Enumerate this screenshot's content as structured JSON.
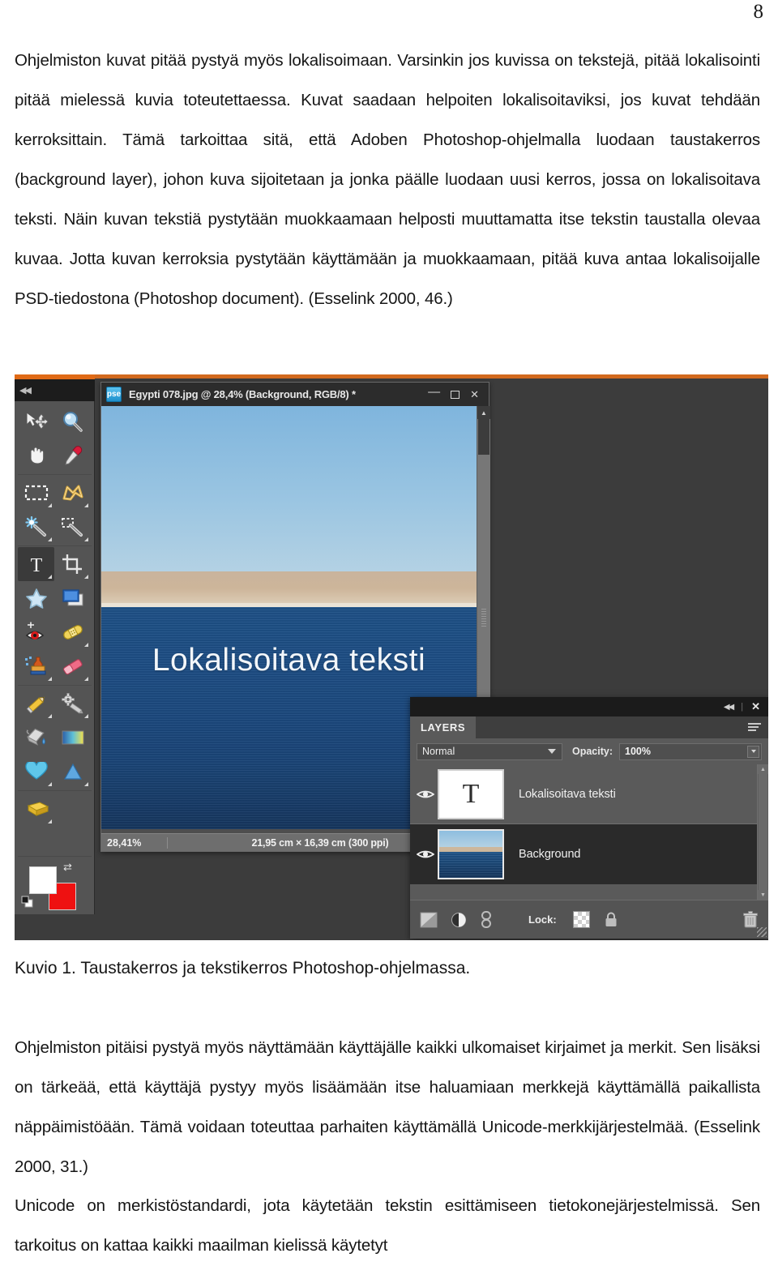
{
  "document": {
    "page_number": "8",
    "paragraphs": {
      "intro": "Ohjelmiston kuvat pitää pystyä myös lokalisoimaan. Varsinkin jos kuvissa on tekstejä, pitää lokalisointi pitää mielessä kuvia toteutettaessa. Kuvat saadaan helpoiten lokalisoitaviksi, jos kuvat tehdään kerroksittain. Tämä tarkoittaa sitä, että Adoben Photoshop-ohjelmalla luodaan taustakerros (background layer), johon kuva sijoitetaan ja jonka päälle luodaan uusi kerros, jossa on lokalisoitava teksti. Näin kuvan tekstiä pystytään muokkaamaan helposti muuttamatta itse tekstin taustalla olevaa kuvaa. Jotta kuvan kerroksia pystytään käyttämään ja muokkaamaan, pitää kuva antaa lokalisoijalle PSD-tiedostona (Photoshop document). (Esselink 2000, 46.)",
      "caption": "Kuvio 1. Taustakerros ja tekstikerros Photoshop-ohjelmassa.",
      "second": "Ohjelmiston pitäisi pystyä myös näyttämään käyttäjälle kaikki ulkomaiset kirjaimet ja merkit. Sen lisäksi on tärkeää, että käyttäjä pystyy myös lisäämään itse haluamiaan merkkejä käyttämällä paikallista näppäimistöään. Tämä voidaan toteuttaa parhaiten käyttämällä Unicode-merkkijärjestelmää. (Esselink 2000, 31.)",
      "third": "Unicode on merkistöstandardi, jota käytetään tekstin esittämiseen tietokonejärjestelmissä. Sen tarkoitus on kattaa kaikki maailman kielissä käytetyt"
    }
  },
  "photoshop": {
    "accent_color": "#e06a16",
    "toolbar": {
      "collapse_label": "◀◀",
      "tools": [
        {
          "name": "move-tool",
          "has_submenu": false
        },
        {
          "name": "zoom-tool",
          "has_submenu": false
        },
        {
          "name": "hand-tool",
          "has_submenu": false
        },
        {
          "name": "eyedropper-tool",
          "has_submenu": false
        },
        {
          "name": "rectangular-marquee-tool",
          "has_submenu": true
        },
        {
          "name": "lasso-tool",
          "has_submenu": true
        },
        {
          "name": "magic-wand-tool",
          "has_submenu": true
        },
        {
          "name": "quick-selection-tool",
          "has_submenu": true
        },
        {
          "name": "type-tool",
          "has_submenu": true,
          "active": true
        },
        {
          "name": "crop-tool",
          "has_submenu": true
        },
        {
          "name": "cookie-cutter-tool",
          "has_submenu": false
        },
        {
          "name": "recompose-tool",
          "has_submenu": false
        },
        {
          "name": "red-eye-removal-tool",
          "has_submenu": false
        },
        {
          "name": "healing-brush-tool",
          "has_submenu": true
        },
        {
          "name": "clone-stamp-tool",
          "has_submenu": true
        },
        {
          "name": "eraser-tool",
          "has_submenu": true
        },
        {
          "name": "pencil-tool",
          "has_submenu": true
        },
        {
          "name": "smart-brush-tool",
          "has_submenu": true
        },
        {
          "name": "paint-bucket-tool",
          "has_submenu": false
        },
        {
          "name": "gradient-tool",
          "has_submenu": false
        },
        {
          "name": "custom-shape-tool",
          "has_submenu": true
        },
        {
          "name": "blur-tool",
          "has_submenu": true
        },
        {
          "name": "sponge-tool",
          "has_submenu": true
        }
      ],
      "foreground_color": "#ffffff",
      "background_color": "#ee1111"
    },
    "image_window": {
      "app_badge": "pse",
      "title": "Egypti 078.jpg @ 28,4% (Background, RGB/8) *",
      "minimize_label": "—",
      "close_label": "✕",
      "canvas_text": "Lokalisoitava teksti",
      "status": {
        "zoom": "28,41%",
        "dimensions": "21,95 cm × 16,39 cm (300 ppi)",
        "expand_label": "▶"
      }
    },
    "layers_panel": {
      "collapse_label": "◀◀",
      "divider_label": "|",
      "close_label": "✕",
      "tab_label": "LAYERS",
      "blend_mode": "Normal",
      "opacity_label": "Opacity:",
      "opacity_value": "100%",
      "layers": [
        {
          "name": "Lokalisoitava teksti",
          "type": "text",
          "thumb_glyph": "T",
          "visible": true,
          "selected": false
        },
        {
          "name": "Background",
          "type": "image",
          "visible": true,
          "selected": true
        }
      ],
      "footer": {
        "new_adjustment_layer": "new-adjustment-layer-icon",
        "new_layer": "new-layer-icon",
        "link_layers": "link-layers-icon",
        "lock_label": "Lock:",
        "lock_transparency": "lock-transparent-pixels-icon",
        "lock_all": "lock-all-icon",
        "delete_layer": "delete-layer-icon"
      }
    }
  }
}
